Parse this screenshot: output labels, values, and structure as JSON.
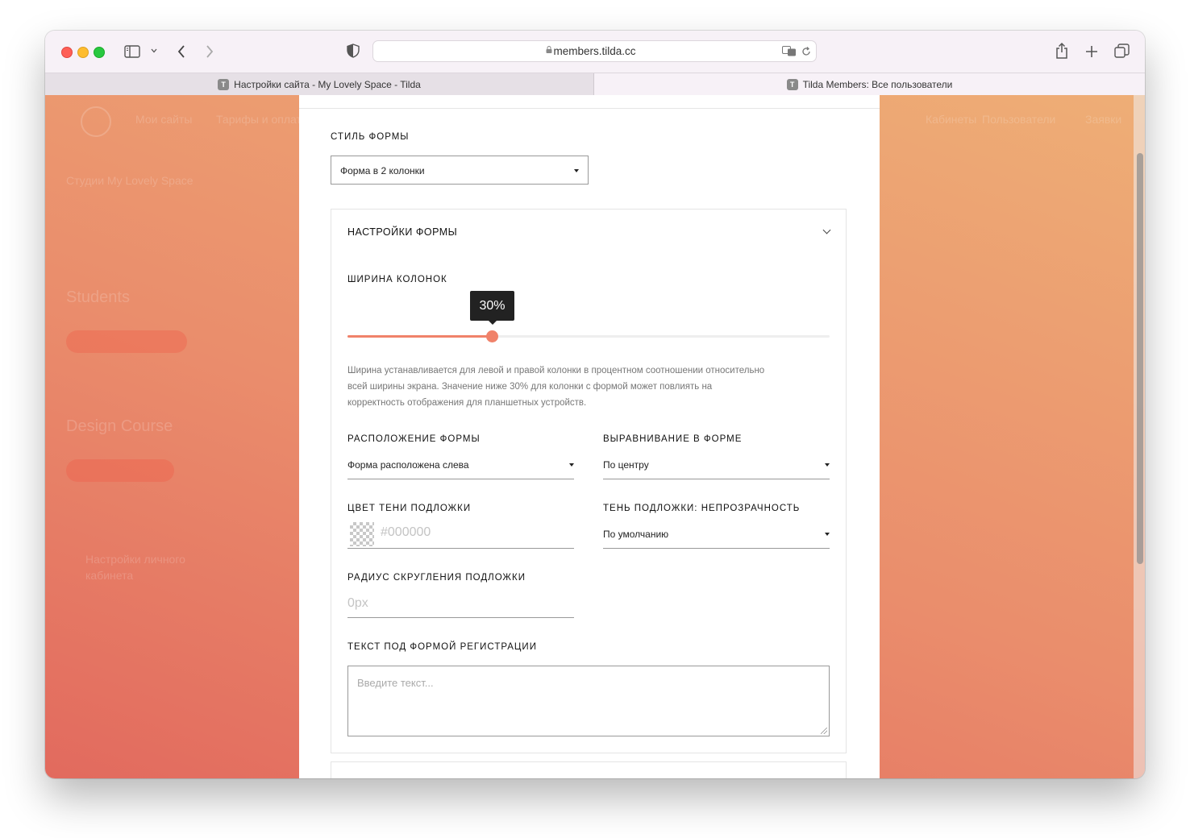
{
  "browser": {
    "url": "members.tilda.cc",
    "tabs": [
      {
        "label": "Настройки сайта - My Lovely Space - Tilda",
        "favicon": "T",
        "active": false
      },
      {
        "label": "Tilda Members: Все пользователи",
        "favicon": "T",
        "active": true
      }
    ]
  },
  "panel": {
    "form_style_label": "СТИЛЬ ФОРМЫ",
    "form_style_value": "Форма в 2 колонки",
    "settings_section": {
      "title": "НАСТРОЙКИ ФОРМЫ",
      "column_width": {
        "label": "ШИРИНА КОЛОНОК",
        "value_text": "30%",
        "value_fraction": 0.3,
        "accent_color": "#f0826a",
        "hint": "Ширина устанавливается для левой и правой колонки в процентном соотношении относительно всей ширины экрана. Значение ниже 30% для колонки с формой может повлиять на корректность отображения для планшетных устройств."
      },
      "form_position": {
        "label": "РАСПОЛОЖЕНИЕ ФОРМЫ",
        "value": "Форма расположена слева"
      },
      "form_alignment": {
        "label": "ВЫРАВНИВАНИЕ В ФОРМЕ",
        "value": "По центру"
      },
      "shadow_color": {
        "label": "ЦВЕТ ТЕНИ ПОДЛОЖКИ",
        "placeholder": "#000000"
      },
      "shadow_opacity": {
        "label": "ТЕНЬ ПОДЛОЖКИ: НЕПРОЗРАЧНОСТЬ",
        "value": "По умолчанию"
      },
      "corner_radius": {
        "label": "РАДИУС СКРУГЛЕНИЯ ПОДЛОЖКИ",
        "placeholder": "0px"
      },
      "text_below_form": {
        "label": "ТЕКСТ ПОД ФОРМОЙ РЕГИСТРАЦИИ",
        "placeholder": "Введите текст..."
      }
    }
  },
  "background_page": {
    "top_nav": [
      "Мои сайты",
      "Тарифы и оплата"
    ],
    "right_nav": [
      "Кабинеты",
      "Пользователи",
      "Заявки"
    ],
    "left_items": [
      "Студии My Lovely Space",
      "Students",
      "Design Course",
      "Настройки личного кабинета"
    ]
  }
}
